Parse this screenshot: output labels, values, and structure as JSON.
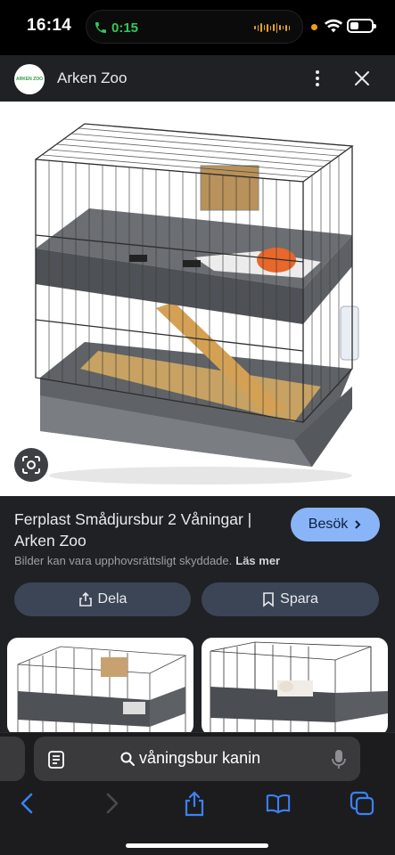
{
  "status_bar": {
    "time": "16:14",
    "call_duration": "0:15",
    "icons": [
      "phone-icon",
      "wifi-icon",
      "battery-icon"
    ]
  },
  "header": {
    "logo_text": "ARKEN ZOO",
    "site_name": "Arken Zoo",
    "icons": [
      "more-icon",
      "close-icon"
    ]
  },
  "result": {
    "title": "Ferplast Smådjursbur 2 Våningar | Arken Zoo",
    "visit_label": "Besök",
    "copyright_text": "Bilder kan vara upphovsrättsligt skyddade.",
    "read_more_label": "Läs mer",
    "share_label": "Dela",
    "save_label": "Spara"
  },
  "browser": {
    "search_text": "våningsbur kanin",
    "icons": [
      "reader-icon",
      "search-icon",
      "mic-icon",
      "back-icon",
      "forward-icon",
      "share-icon",
      "bookmarks-icon",
      "tabs-icon"
    ]
  },
  "colors": {
    "accent": "#8ab4f8",
    "call_green": "#34c759",
    "panel": "#202124",
    "button": "#3c4556"
  }
}
